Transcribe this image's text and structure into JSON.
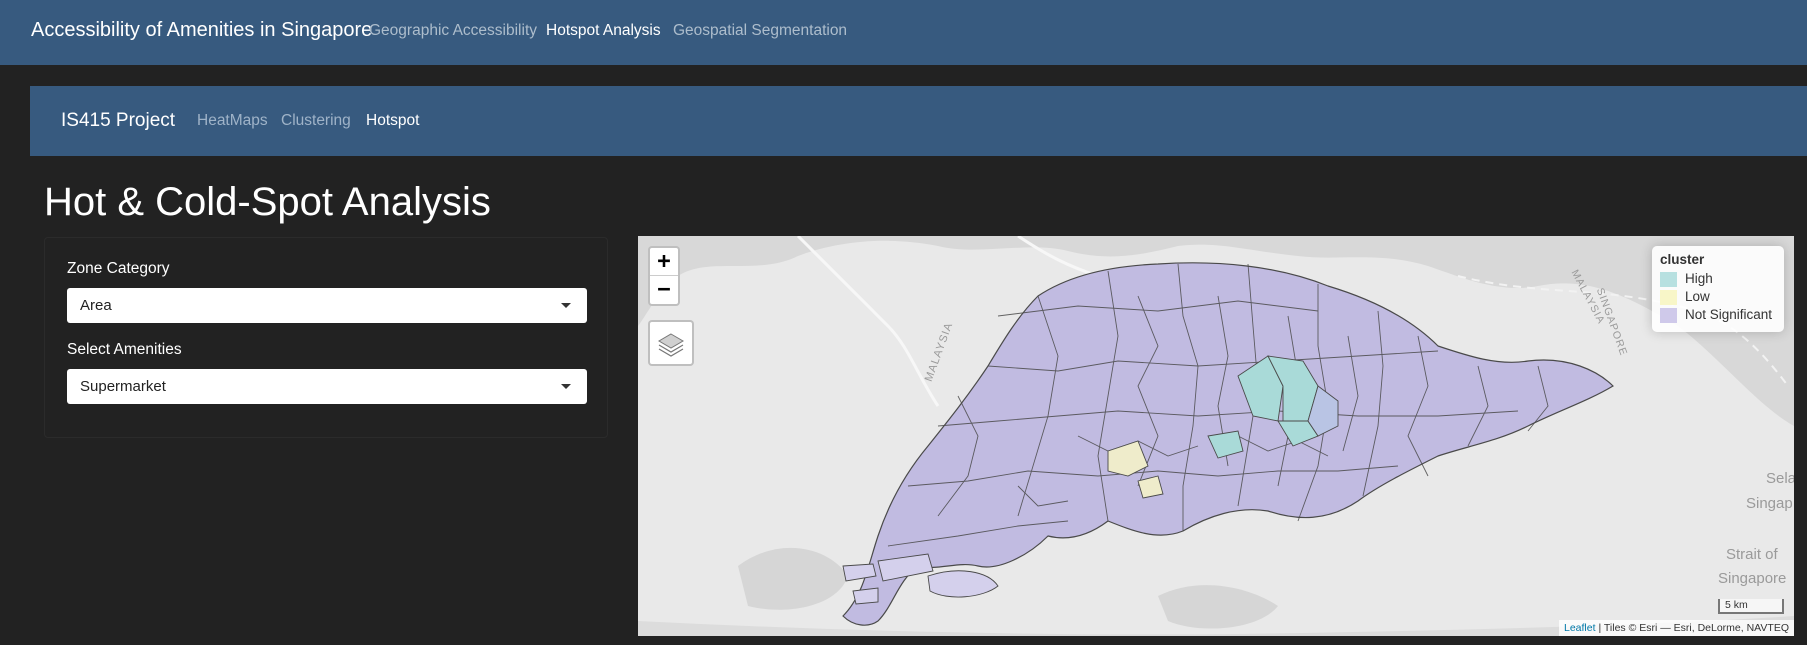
{
  "app": {
    "title": "Accessibility of Amenities in Singapore",
    "nav": [
      {
        "label": "Geographic Accessibility",
        "active": false
      },
      {
        "label": "Hotspot Analysis",
        "active": true
      },
      {
        "label": "Geospatial Segmentation",
        "active": false
      }
    ]
  },
  "subnav": {
    "brand": "IS415 Project",
    "tabs": [
      {
        "label": "HeatMaps",
        "active": false
      },
      {
        "label": "Clustering",
        "active": false
      },
      {
        "label": "Hotspot",
        "active": true
      }
    ]
  },
  "page": {
    "title": "Hot & Cold-Spot Analysis"
  },
  "sidebar": {
    "zone_label": "Zone Category",
    "zone_value": "Area",
    "amenity_label": "Select Amenities",
    "amenity_value": "Supermarket"
  },
  "map": {
    "zoom_in": "+",
    "zoom_out": "−",
    "legend": {
      "title": "cluster",
      "items": [
        {
          "label": "High",
          "color": "#b7e0e0"
        },
        {
          "label": "Low",
          "color": "#f8f6c8"
        },
        {
          "label": "Not Significant",
          "color": "#cfc9ea"
        }
      ]
    },
    "scale": "5 km",
    "attribution_link": "Leaflet",
    "attribution_text": "| Tiles © Esri — Esri, DeLorme, NAVTEQ",
    "labels": {
      "malaysia_left": "MALAYSIA",
      "malaysia_right": "MALAYSIA",
      "singapore_right": "SINGAPORE",
      "sela": "Sela",
      "singap": "Singap",
      "strait_of": "Strait of",
      "singapore_strait": "Singapore"
    },
    "colors": {
      "polygon": "#bdb6e0",
      "high": "#a9dad8",
      "low": "#efeccb",
      "edge": "#4a4a4a",
      "sea": "#e8e8e8",
      "land": "#d6d6d6"
    }
  }
}
